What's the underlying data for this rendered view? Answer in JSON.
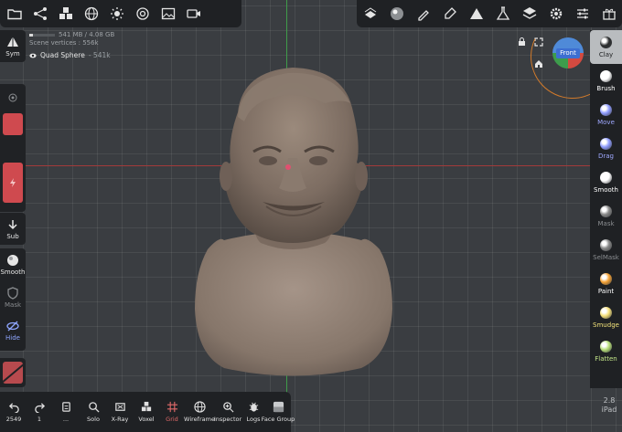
{
  "topbar_left": {
    "icons": [
      "folder-icon",
      "share-graph-icon",
      "cubes-icon",
      "sphere-grid-icon",
      "sun-icon",
      "target-icon",
      "image-icon",
      "video-icon"
    ]
  },
  "topbar_right": {
    "icons": [
      "layers-stack-icon",
      "material-ball-icon",
      "brush-icon",
      "pen-icon",
      "triangle-icon",
      "flask-icon",
      "layers-icon",
      "gear-icon",
      "sliders-icon",
      "gift-icon"
    ]
  },
  "info": {
    "memory": "541 MB / 4.08 GB",
    "memory_fraction": 0.13,
    "scene_vertices": "Scene vertices : 556k",
    "mesh_name": "Quad Sphere",
    "mesh_count": "- 541k"
  },
  "left_toolbar": {
    "sym": "Sym",
    "sub": "Sub",
    "smooth": "Smooth",
    "mask": "Mask",
    "hide": "Hide"
  },
  "right_toolbar": {
    "tools": [
      {
        "label": "Clay",
        "color": "#2a2c2e",
        "label_color": "#1b1d1f"
      },
      {
        "label": "Brush",
        "color": "#ffffff",
        "label_color": "#ffffff"
      },
      {
        "label": "Move",
        "color": "#8f9cff",
        "label_color": "#9fa8ff"
      },
      {
        "label": "Drag",
        "color": "#8f9cff",
        "label_color": "#9fa8ff"
      },
      {
        "label": "Smooth",
        "color": "#ffffff",
        "label_color": "#ffffff"
      },
      {
        "label": "Mask",
        "color": "#888888",
        "label_color": "#8a8d90"
      },
      {
        "label": "SelMask",
        "color": "#888888",
        "label_color": "#8a8d90"
      },
      {
        "label": "Paint",
        "color": "#f5a235",
        "label_color": "#ffffff"
      },
      {
        "label": "Smudge",
        "color": "#f5e07a",
        "label_color": "#f2e27a"
      },
      {
        "label": "Flatten",
        "color": "#b8e07a",
        "label_color": "#c6e88a"
      }
    ]
  },
  "bottom_bar": {
    "undo_count": "2549",
    "redo_count": "1",
    "menu_label": "...",
    "solo": "Solo",
    "xray": "X-Ray",
    "voxel": "Voxel",
    "grid": "Grid",
    "wireframe": "Wireframe",
    "inspector": "Inspector",
    "logs": "Logs",
    "face_group": "Face Group"
  },
  "nav_cube": {
    "label": "Front"
  },
  "version": {
    "number": "2.8",
    "device": "iPad"
  }
}
